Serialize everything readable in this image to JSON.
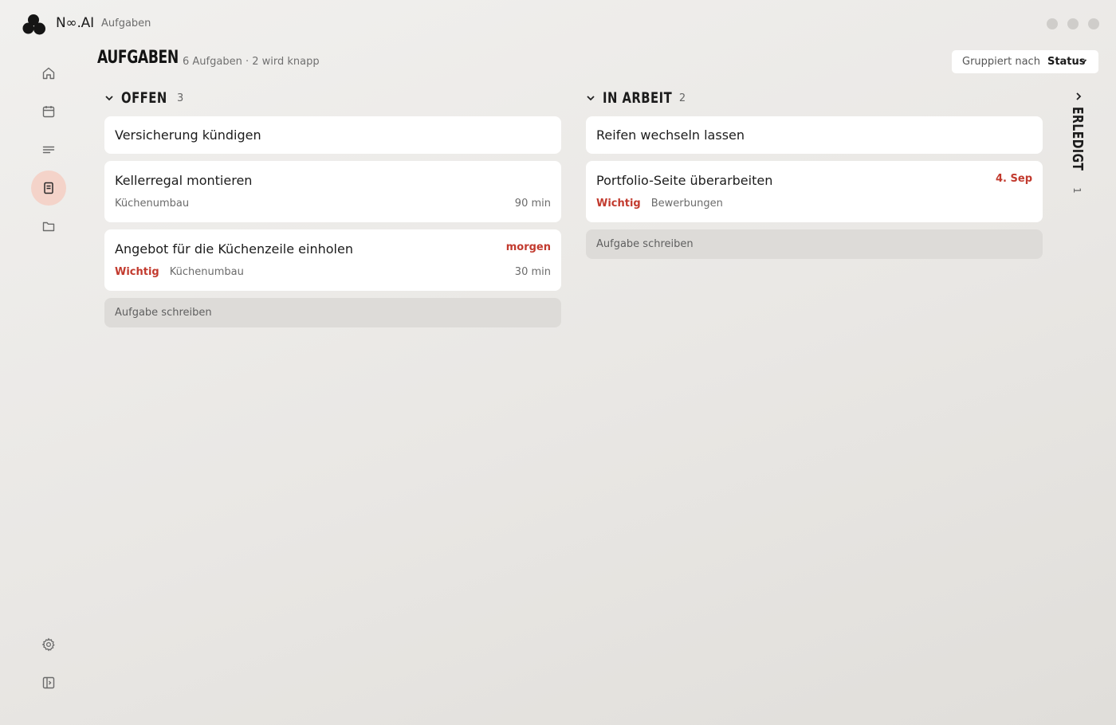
{
  "app": {
    "brand": "N∞.AI",
    "breadcrumb": "Aufgaben"
  },
  "header": {
    "title": "AUFGABEN",
    "subtitle": "6 Aufgaben · 2 wird knapp",
    "group_label": "Gruppiert nach",
    "group_value": "Status"
  },
  "sidebar": [
    {
      "icon": "home-icon"
    },
    {
      "icon": "calendar-icon"
    },
    {
      "icon": "list-icon"
    },
    {
      "icon": "task-icon",
      "active": true
    },
    {
      "icon": "folder-icon"
    },
    {
      "icon": "gear-icon"
    },
    {
      "icon": "sidebar-toggle-icon"
    }
  ],
  "columns": [
    {
      "name": "OFFEN",
      "count": "3",
      "cards": [
        {
          "title": "Versicherung kündigen"
        },
        {
          "title": "Kellerregal montieren",
          "project": "Küchenumbau",
          "duration": "90 min"
        },
        {
          "title": "Angebot für die Küchenzeile einholen",
          "due": "morgen",
          "priority": "Wichtig",
          "project": "Küchenumbau",
          "duration": "30 min"
        }
      ],
      "add_placeholder": "Aufgabe schreiben"
    },
    {
      "name": "IN ARBEIT",
      "count": "2",
      "cards": [
        {
          "title": "Reifen wechseln lassen"
        },
        {
          "title": "Portfolio-Seite überarbeiten",
          "due": "4. Sep",
          "priority": "Wichtig",
          "project": "Bewerbungen"
        }
      ],
      "add_placeholder": "Aufgabe schreiben"
    },
    {
      "name": "ERLEDIGT",
      "count": "1",
      "collapsed": true
    }
  ],
  "colors": {
    "accent": "#c23a2e",
    "active_bg": "#f4d3c9",
    "card": "#ffffff",
    "add_row": "#dddbd8"
  }
}
